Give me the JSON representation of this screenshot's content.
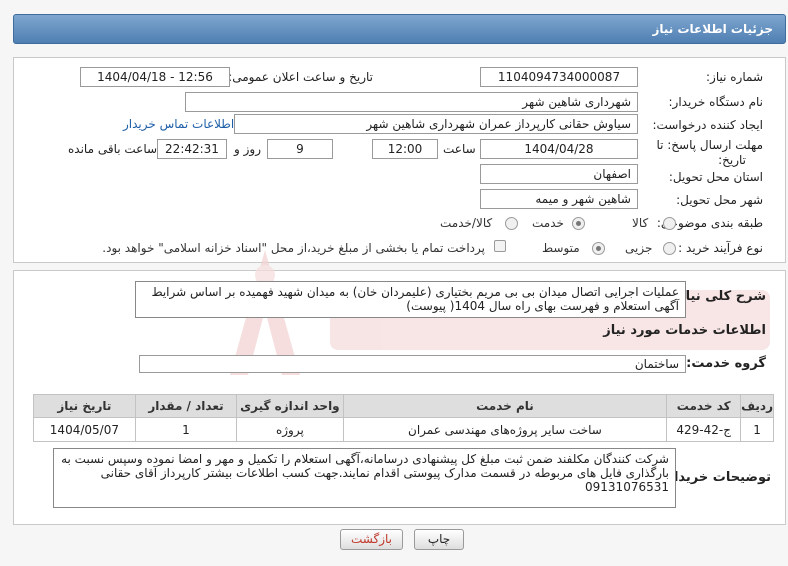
{
  "header": {
    "title": "جزئیات اطلاعات نیاز"
  },
  "form": {
    "need_number": {
      "label": "شماره نیاز:",
      "value": "1104094734000087"
    },
    "announce_datetime": {
      "label": "تاریخ و ساعت اعلان عمومی:",
      "value": "1404/04/18 - 12:56"
    },
    "buyer_org": {
      "label": "نام دستگاه خریدار:",
      "value": "شهرداری شاهین شهر"
    },
    "requester": {
      "label": "ایجاد کننده درخواست:",
      "value": "سیاوش حقانی کارپرداز عمران شهرداری شاهین شهر",
      "contact_link": "اطلاعات تماس خریدار"
    },
    "deadline": {
      "label_line1": "مهلت ارسال پاسخ: تا",
      "label_line2": "تاریخ:",
      "date": "1404/04/28",
      "time_label": "ساعت",
      "time": "12:00",
      "days": "9",
      "days_label": "روز و",
      "remaining": "22:42:31",
      "remaining_label": "ساعت باقی مانده"
    },
    "province": {
      "label": "استان محل تحویل:",
      "value": "اصفهان"
    },
    "city": {
      "label": "شهر محل تحویل:",
      "value": "شاهین شهر و میمه"
    },
    "category": {
      "label": "طبقه بندی موضوعی:",
      "options": [
        "کالا",
        "خدمت",
        "کالا/خدمت"
      ],
      "selected": "خدمت"
    },
    "purchase_type": {
      "label": "نوع فرآیند خرید :",
      "options": [
        "جزیی",
        "متوسط"
      ],
      "selected": "متوسط",
      "payment_note": "پرداخت تمام یا بخشی از مبلغ خرید،از محل \"اسناد خزانه اسلامی\" خواهد بود."
    }
  },
  "summary": {
    "label": "شرح کلی نیاز:",
    "text": "عملیات اجرایی اتصال میدان بی بی مریم بختیاری (علیمردان خان) به میدان شهید فهمیده بر اساس شرایط آگهی استعلام و فهرست بهای راه سال 1404( پیوست)"
  },
  "services": {
    "section_title": "اطلاعات خدمات مورد نیاز",
    "group_label": "گروه خدمت:",
    "group_value": "ساختمان",
    "columns": [
      "ردیف",
      "کد خدمت",
      "نام خدمت",
      "واحد اندازه گیری",
      "تعداد / مقدار",
      "تاریخ نیاز"
    ],
    "rows": [
      {
        "row": "1",
        "code": "ج-42-429",
        "name": "ساخت سایر پروژه‌های مهندسی عمران",
        "unit": "پروژه",
        "qty": "1",
        "date": "1404/05/07"
      }
    ]
  },
  "buyer_notes": {
    "label": "توضیحات خریدار:",
    "text": "شرکت کنندگان مکلفند ضمن ثبت مبلغ کل پیشنهادی درسامانه،آگهی استعلام را  تکمیل و مهر و امضا نموده وسپس نسبت به بارگذاری فایل های مربوطه در قسمت مدارک پیوستی اقدام نمایند.جهت کسب اطلاعات بیشتر کارپرداز آقای حقانی 09131076531"
  },
  "buttons": {
    "print": "چاپ",
    "back": "بازگشت"
  },
  "colors": {
    "header": "#5b88b8",
    "link": "#1f5fa8",
    "watermark": "#f3c8c8"
  }
}
